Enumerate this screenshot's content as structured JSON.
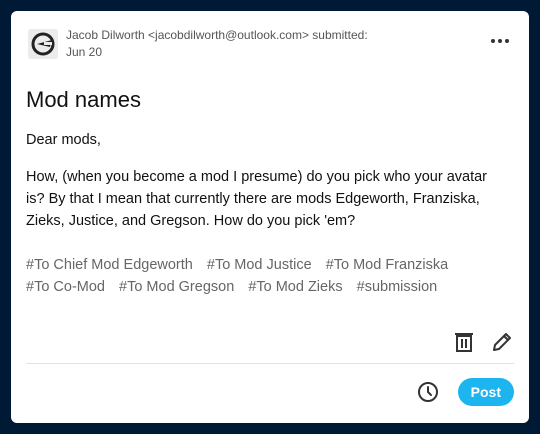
{
  "submission": {
    "submitter": "Jacob Dilworth <jacobdilworth@outlook.com> submitted:",
    "date": "Jun 20",
    "title": "Mod names",
    "greeting": "Dear mods,",
    "body": "How, (when you become a mod I presume) do you pick who your avatar is? By that I mean that currently there are mods Edgeworth, Franziska, Zieks, Justice, and Gregson. How do you pick 'em?",
    "tags": [
      "#To Chief Mod Edgeworth",
      "#To Mod Justice",
      "#To Mod Franziska",
      "#To Co-Mod",
      "#To Mod Gregson",
      "#To Mod Zieks",
      "#submission"
    ]
  },
  "actions": {
    "post_label": "Post"
  },
  "icons": {
    "more": "more-horizontal-icon",
    "delete": "trash-icon",
    "edit": "pencil-icon",
    "schedule": "clock-icon",
    "avatar": "avatar-logo"
  },
  "colors": {
    "page_background": "#001935",
    "accent": "#1cb5f0",
    "card": "#ffffff"
  }
}
